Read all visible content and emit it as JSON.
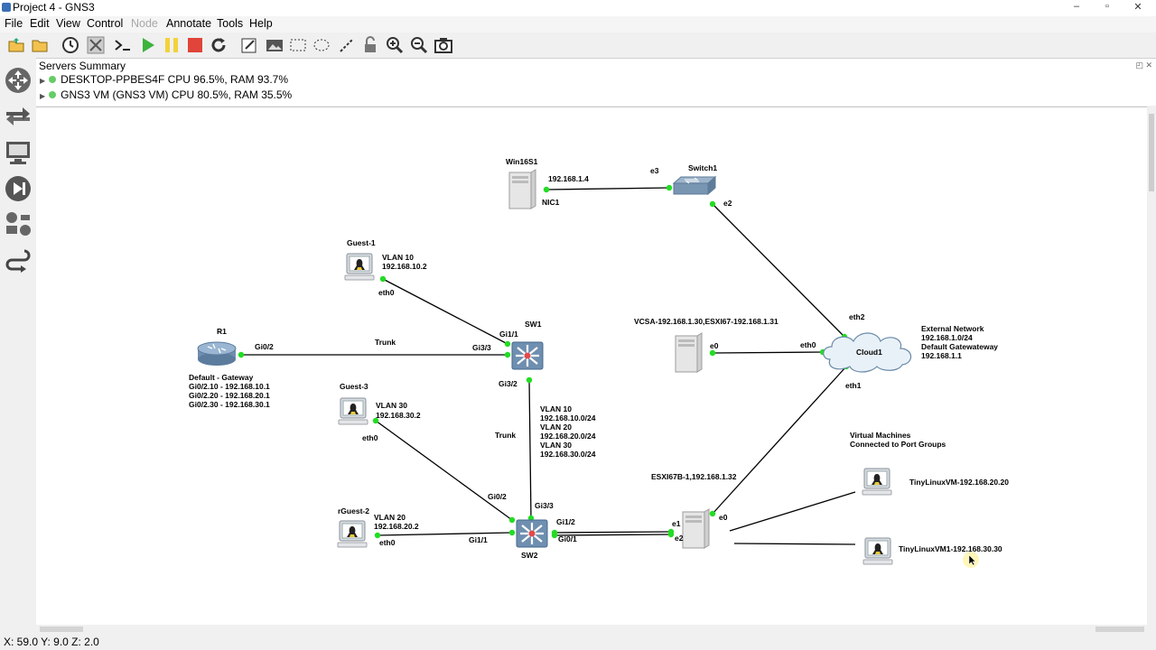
{
  "window": {
    "title": "Project 4 - GNS3",
    "controls": {
      "minimize": "–",
      "maximize": "▫",
      "close": "✕"
    }
  },
  "menu": {
    "file": "File",
    "edit": "Edit",
    "view": "View",
    "control": "Control",
    "node": "Node",
    "annotate": "Annotate",
    "tools": "Tools",
    "help": "Help"
  },
  "servers": {
    "title": "Servers Summary",
    "items": [
      {
        "label": "DESKTOP-PPBES4F CPU 96.5%, RAM 93.7%"
      },
      {
        "label": "GNS3 VM (GNS3 VM) CPU 80.5%, RAM 35.5%"
      }
    ]
  },
  "topology": {
    "nodes": {
      "win16s1": {
        "name": "Win16S1",
        "ip": "192.168.1.4",
        "port": "NIC1"
      },
      "switch1": {
        "name": "Switch1",
        "port_e3": "e3",
        "port_e2": "e2"
      },
      "guest1": {
        "name": "Guest-1",
        "vlan": "VLAN 10",
        "ip": "192.168.10.2",
        "port": "eth0"
      },
      "sw1": {
        "name": "SW1",
        "port_gi11": "Gi1/1",
        "port_gi33": "Gi3/3",
        "port_gi32": "Gi3/2"
      },
      "r1": {
        "name": "R1",
        "port": "Gi0/2",
        "desc": [
          "Default - Gateway",
          "Gi0/2.10 - 192.168.10.1",
          "Gi0/2.20 - 192.168.20.1",
          "Gi0/2.30 - 192.168.30.1"
        ]
      },
      "trunk1": "Trunk",
      "guest3": {
        "name": "Guest-3",
        "vlan": "VLAN 30",
        "ip": "192.168.30.2",
        "port": "eth0"
      },
      "trunk2": "Trunk",
      "vlan_list": [
        "VLAN 10",
        "192.168.10.0/24",
        "VLAN 20",
        "192.168.20.0/24",
        "VLAN 30",
        "192.168.30.0/24"
      ],
      "rguest2": {
        "name": "rGuest-2",
        "vlan": "VLAN 20",
        "ip": "192.168.20.2",
        "port": "eth0"
      },
      "sw2": {
        "name": "SW2",
        "port_gi02": "Gi0/2",
        "port_gi33": "Gi3/3",
        "port_gi11": "Gi1/1",
        "port_gi12": "Gi1/2",
        "port_gi01": "Gi0/1"
      },
      "vcsa": {
        "name": "VCSA-192.168.1.30,ESXI67-192.168.1.31",
        "port": "e0"
      },
      "cloud1": {
        "name": "Cloud1",
        "port_eth0": "eth0",
        "port_eth1": "eth1",
        "port_eth2": "eth2"
      },
      "external": [
        "External Network",
        "192.168.1.0/24",
        "Default Gatewateway",
        "192.168.1.1"
      ],
      "esxi": {
        "name": "ESXI67B-1,192.168.1.32",
        "port_e0": "e0",
        "port_e1": "e1",
        "port_e2": "e2"
      },
      "vm_note": [
        "Virtual Machines",
        "Connected to Port Groups"
      ],
      "tinyvm1": {
        "name": "TinyLinuxVM-192.168.20.20"
      },
      "tinyvm2": {
        "name": "TinyLinuxVM1-192.168.30.30"
      }
    }
  },
  "status": {
    "coords": "X: 59.0 Y: 9.0 Z: 2.0"
  },
  "colors": {
    "link": "#000000",
    "port_up": "#22dd22",
    "canvas": "#ffffff"
  }
}
